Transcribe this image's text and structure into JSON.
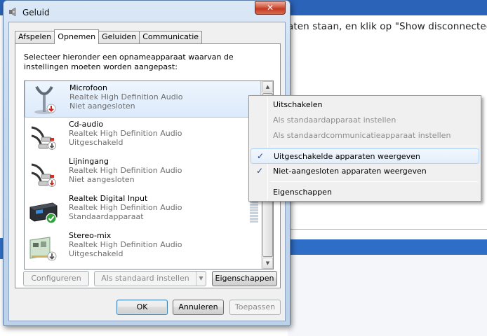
{
  "background": {
    "text": "aten staan, en klik op \"Show disconnected"
  },
  "window": {
    "title": "Geluid",
    "close_label": "✕"
  },
  "tabs": [
    {
      "label": "Afspelen",
      "active": false
    },
    {
      "label": "Opnemen",
      "active": true
    },
    {
      "label": "Geluiden",
      "active": false
    },
    {
      "label": "Communicatie",
      "active": false
    }
  ],
  "instructions": "Selecteer hieronder een opnameapparaat waarvan de instellingen moeten worden aangepast:",
  "devices": [
    {
      "name": "Microfoon",
      "driver": "Realtek High Definition Audio",
      "status": "Niet aangesloten",
      "icon": "microphone-icon",
      "badge": "down-arrow-red",
      "selected": true
    },
    {
      "name": "Cd-audio",
      "driver": "Realtek High Definition Audio",
      "status": "Uitgeschakeld",
      "icon": "rca-cable-icon",
      "badge": "down-arrow-gray",
      "selected": false
    },
    {
      "name": "Lijningang",
      "driver": "Realtek High Definition Audio",
      "status": "Niet aangesloten",
      "icon": "rca-cable-icon",
      "badge": "down-arrow-red",
      "selected": false
    },
    {
      "name": "Realtek Digital Input",
      "driver": "Realtek High Definition Audio",
      "status": "Standaardapparaat",
      "icon": "digital-input-device-icon",
      "badge": "green-check",
      "selected": false
    },
    {
      "name": "Stereo-mix",
      "driver": "Realtek High Definition Audio",
      "status": "Uitgeschakeld",
      "icon": "sound-card-icon",
      "badge": "down-arrow-gray",
      "selected": false
    }
  ],
  "panel_buttons": {
    "configure": "Configureren",
    "set_default": "Als standaard instellen",
    "properties": "Eigenschappen"
  },
  "dialog_buttons": {
    "ok": "OK",
    "cancel": "Annuleren",
    "apply": "Toepassen"
  },
  "context_menu": {
    "disable": "Uitschakelen",
    "set_default_device": "Als standaardapparaat instellen",
    "set_default_comm": "Als standaardcommunicatieapparaat instellen",
    "show_disabled": "Uitgeschakelde apparaten weergeven",
    "show_disconnected": "Niet-aangesloten apparaten weergeven",
    "properties": "Eigenschappen",
    "check": "✓"
  },
  "colors": {
    "selection": "#dbeafc",
    "accent": "#2e6ec6",
    "close": "#c23a22"
  }
}
